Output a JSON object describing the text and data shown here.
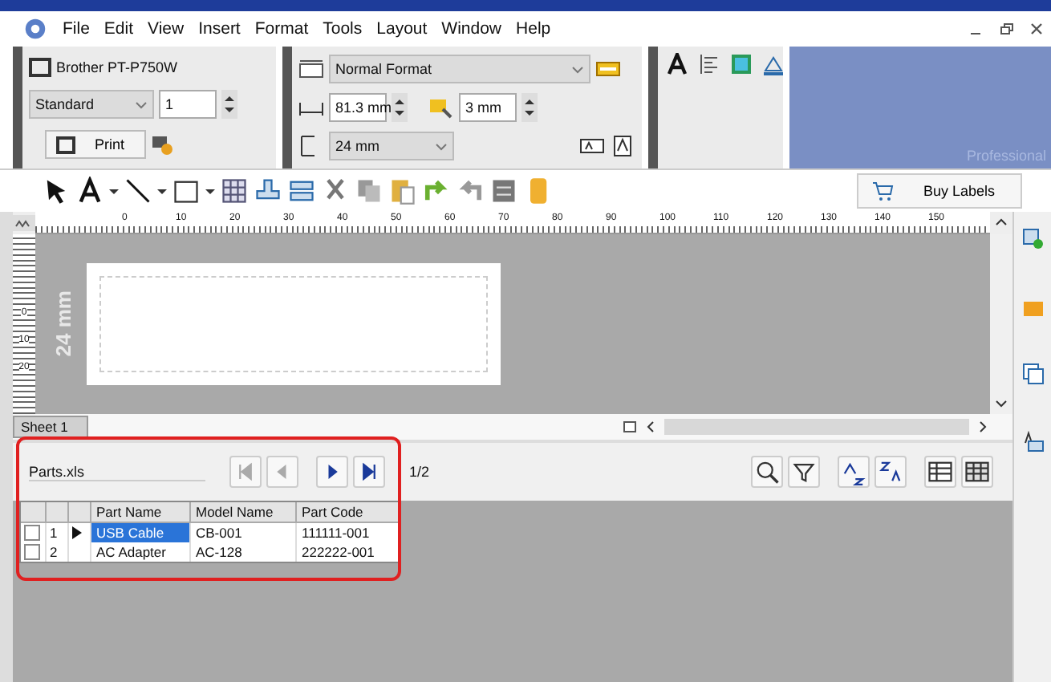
{
  "menu": [
    "File",
    "Edit",
    "View",
    "Insert",
    "Format",
    "Tools",
    "Layout",
    "Window",
    "Help"
  ],
  "printer": {
    "name": "Brother PT-P750W",
    "mode": "Standard",
    "copies": "1",
    "print_button": "Print"
  },
  "format": {
    "style": "Normal Format",
    "length": "81.3 mm",
    "margin": "3 mm",
    "tape_width": "24 mm"
  },
  "edition": "Professional",
  "buy_labels": "Buy Labels",
  "ruler": [
    "0",
    "10",
    "20",
    "30",
    "40",
    "50",
    "60",
    "70",
    "80",
    "90",
    "100",
    "110",
    "120",
    "130",
    "140",
    "150"
  ],
  "vertical_ruler": [
    "0",
    "10",
    "20"
  ],
  "label": {
    "tape_width": "24 mm"
  },
  "sheets": [
    {
      "label": "Sheet 1",
      "selected": true
    }
  ],
  "database": {
    "file": "Parts.xls",
    "page": "1/2",
    "columns": [
      "Part Name",
      "Model Name",
      "Part Code"
    ],
    "rows": [
      {
        "number": "1",
        "checked": false,
        "selected": true,
        "cells": [
          "USB Cable",
          "CB-001",
          "111111-001"
        ]
      },
      {
        "number": "2",
        "checked": false,
        "selected": false,
        "cells": [
          "AC Adapter",
          "AC-128",
          "222222-001"
        ]
      }
    ]
  }
}
